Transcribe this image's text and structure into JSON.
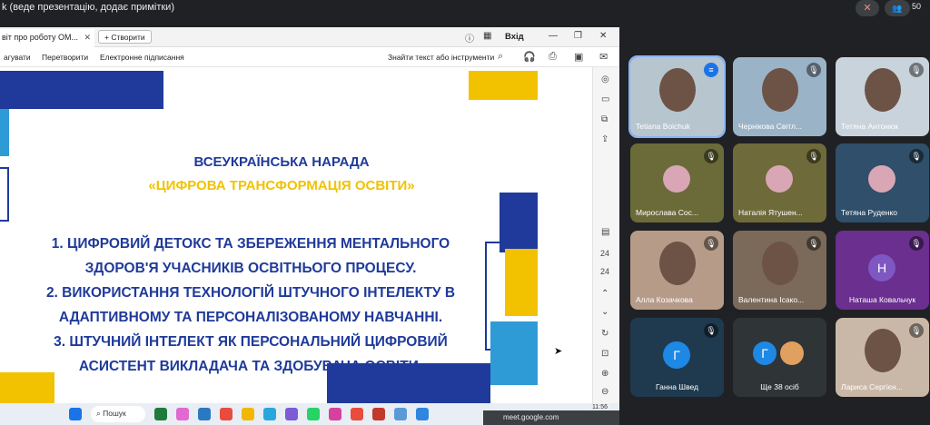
{
  "topbar": {
    "title": "k (веде презентацію, додає примітки)",
    "count": "50"
  },
  "browser": {
    "tab_title": "віт про роботу ОМ...",
    "new_tab_label": "+ Створити",
    "signin_label": "Вхід",
    "menu": [
      "агувати",
      "Перетворити",
      "Електронне підписання"
    ],
    "search_tools": "Знайти текст або інструменти"
  },
  "slide": {
    "heading": "ВСЕУКРАЇНСЬКА НАРАДА",
    "subheading": "«ЦИФРОВА ТРАНСФОРМАЦІЯ ОСВІТИ»",
    "lines": [
      "1. ЦИФРОВИЙ ДЕТОКС ТА ЗБЕРЕЖЕННЯ МЕНТАЛЬНОГО",
      "ЗДОРОВ'Я УЧАСНИКІВ ОСВІТНЬОГО ПРОЦЕСУ.",
      "2. ВИКОРИСТАННЯ ТЕХНОЛОГІЙ ШТУЧНОГО ІНТЕЛЕКТУ В",
      "АДАПТИВНОМУ ТА ПЕРСОНАЛІЗОВАНОМУ НАВЧАННІ.",
      "3. ШТУЧНИЙ ІНТЕЛЕКТ ЯК ПЕРСОНАЛЬНИЙ ЦИФРОВИЙ",
      "АСИСТЕНТ ВИКЛАДАЧА ТА ЗДОБУВАЧА ОСВІТИ."
    ],
    "colors": {
      "blue": "#1f3a9a",
      "yellow": "#f2c200",
      "light_blue": "#2e9bd6"
    }
  },
  "page_panel": {
    "page_current": "24",
    "page_total": "24"
  },
  "taskbar": {
    "search_label": "Пошук",
    "clock": "11:56",
    "url": "meet.google.com"
  },
  "participants": [
    {
      "name": "Tetiana Boichuk",
      "muted": false,
      "kind": "video"
    },
    {
      "name": "Чернікова Світл...",
      "muted": true,
      "kind": "video"
    },
    {
      "name": "Тетяна Антонюк",
      "muted": true,
      "kind": "video"
    },
    {
      "name": "Мирослава Сос...",
      "muted": true,
      "kind": "photo"
    },
    {
      "name": "Наталія Ятушен...",
      "muted": true,
      "kind": "photo"
    },
    {
      "name": "Тетяна Руденко",
      "muted": true,
      "kind": "photo"
    },
    {
      "name": "Алла Козачкова",
      "muted": true,
      "kind": "video"
    },
    {
      "name": "Валентина Ісако...",
      "muted": true,
      "kind": "video"
    },
    {
      "name": "Наташа Ковальчук",
      "muted": true,
      "kind": "letter",
      "letter": "Н"
    },
    {
      "name": "Ганна Швед",
      "muted": true,
      "kind": "letter",
      "letter": "Г"
    },
    {
      "name": "Ще 38 осіб",
      "muted": false,
      "kind": "more",
      "letter": "Г"
    },
    {
      "name": "Лариса Сергієн...",
      "muted": true,
      "kind": "video"
    }
  ]
}
